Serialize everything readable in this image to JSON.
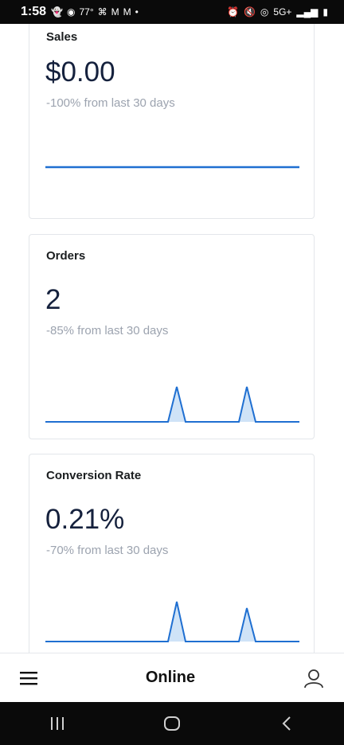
{
  "status_bar": {
    "time": "1:58",
    "temperature": "77°",
    "network": "5G+"
  },
  "cards": [
    {
      "title": "Sales",
      "value": "$0.00",
      "delta": "-100% from last 30 days"
    },
    {
      "title": "Orders",
      "value": "2",
      "delta": "-85% from last 30 days"
    },
    {
      "title": "Conversion Rate",
      "value": "0.21%",
      "delta": "-70% from last 30 days"
    }
  ],
  "bottom_nav": {
    "title": "Online"
  },
  "colors": {
    "line": "#1f6fd1",
    "fill": "#cfe3f7"
  }
}
